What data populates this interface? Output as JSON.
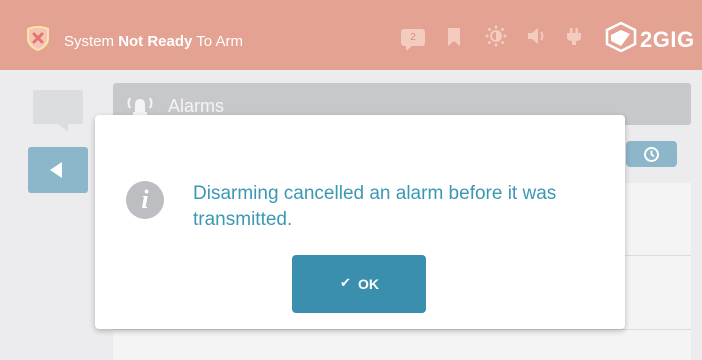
{
  "header": {
    "status_prefix": "System",
    "status_bold": "Not Ready",
    "status_suffix": "To Arm",
    "message_count": "2",
    "brand": "2GIG"
  },
  "page": {
    "title": "Alarms"
  },
  "dialog": {
    "message": "Disarming cancelled an alarm before it was transmitted.",
    "ok_label": "OK"
  },
  "colors": {
    "header_bg": "#e4a293",
    "accent": "#3a8fae",
    "message_text": "#3b98b5"
  },
  "icons": [
    "shield-x-icon",
    "message-icon",
    "bookmark-icon",
    "brightness-icon",
    "volume-icon",
    "power-plug-icon",
    "logo-cube-icon",
    "siren-icon",
    "back-arrow-icon",
    "history-clock-icon",
    "info-icon",
    "checkmark-icon"
  ]
}
